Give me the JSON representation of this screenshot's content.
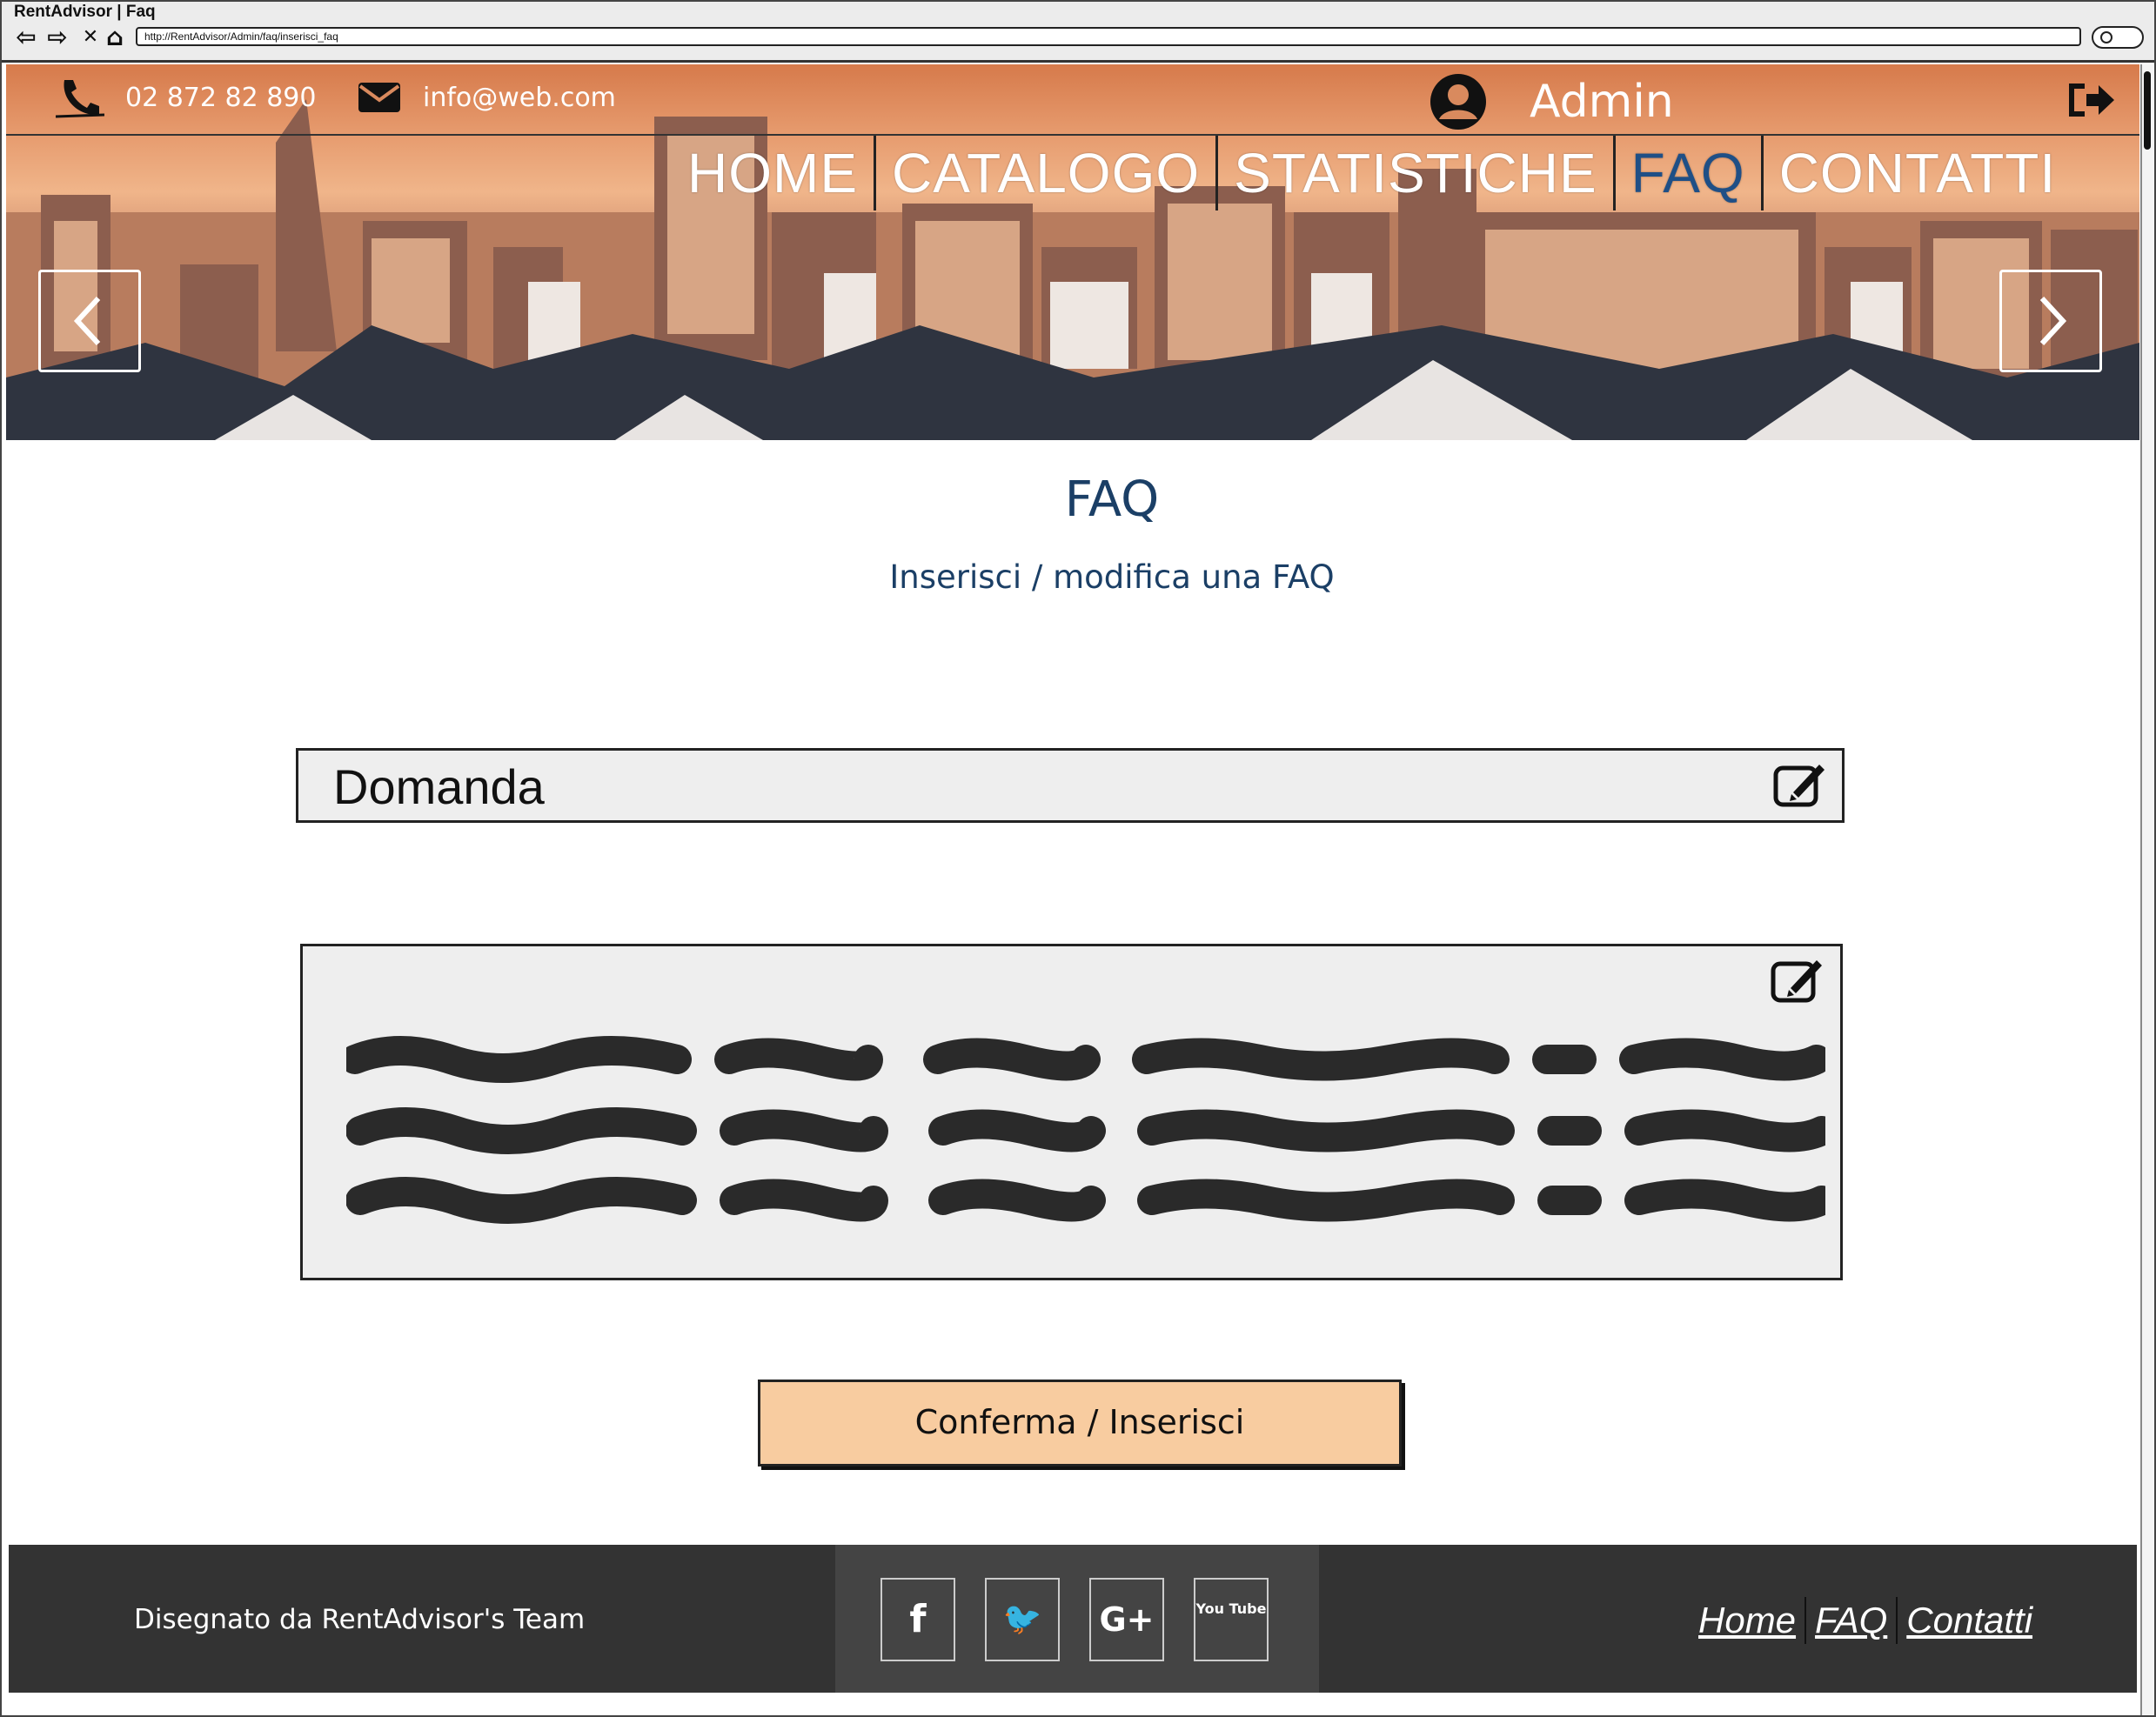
{
  "window": {
    "title": "RentAdvisor | Faq",
    "url": "http://RentAdvisor/Admin/faq/inserisci_faq"
  },
  "browser_controls": [
    {
      "name": "back-icon",
      "glyph": "⇦"
    },
    {
      "name": "forward-icon",
      "glyph": "⇨"
    },
    {
      "name": "stop-icon",
      "glyph": "✕"
    },
    {
      "name": "home-icon",
      "glyph": "⌂"
    }
  ],
  "header": {
    "phone": "02 872 82 890",
    "email": "info@web.com",
    "user_name": "Admin",
    "icons": [
      "phone-icon",
      "envelope-icon",
      "user-avatar-icon",
      "logout-icon",
      "chevron-left-icon",
      "chevron-right-icon"
    ]
  },
  "main_nav": [
    {
      "label": "HOME",
      "active": false
    },
    {
      "label": "CATALOGO",
      "active": false
    },
    {
      "label": "STATISTICHE",
      "active": false
    },
    {
      "label": "FAQ",
      "active": true
    },
    {
      "label": "CONTATTI",
      "active": false
    }
  ],
  "content": {
    "title": "FAQ",
    "subtitle": "Inserisci / modifica una FAQ",
    "question_placeholder": "Domanda",
    "confirm_label": "Conferma / Inserisci"
  },
  "footer": {
    "credit": "Disegnato da RentAdvisor's Team",
    "social": [
      {
        "name": "facebook-icon",
        "glyph": "f"
      },
      {
        "name": "twitter-icon",
        "glyph": "🐦"
      },
      {
        "name": "google-plus-icon",
        "glyph": "G+"
      },
      {
        "name": "youtube-icon",
        "glyph": "You Tube"
      }
    ],
    "links": [
      "Home",
      "FAQ",
      "Contatti"
    ]
  },
  "colors": {
    "accent": "#1f4f86",
    "title": "#1b3f66",
    "button": "#f8cca0",
    "footer": "#333333",
    "field": "#eeeeee"
  }
}
